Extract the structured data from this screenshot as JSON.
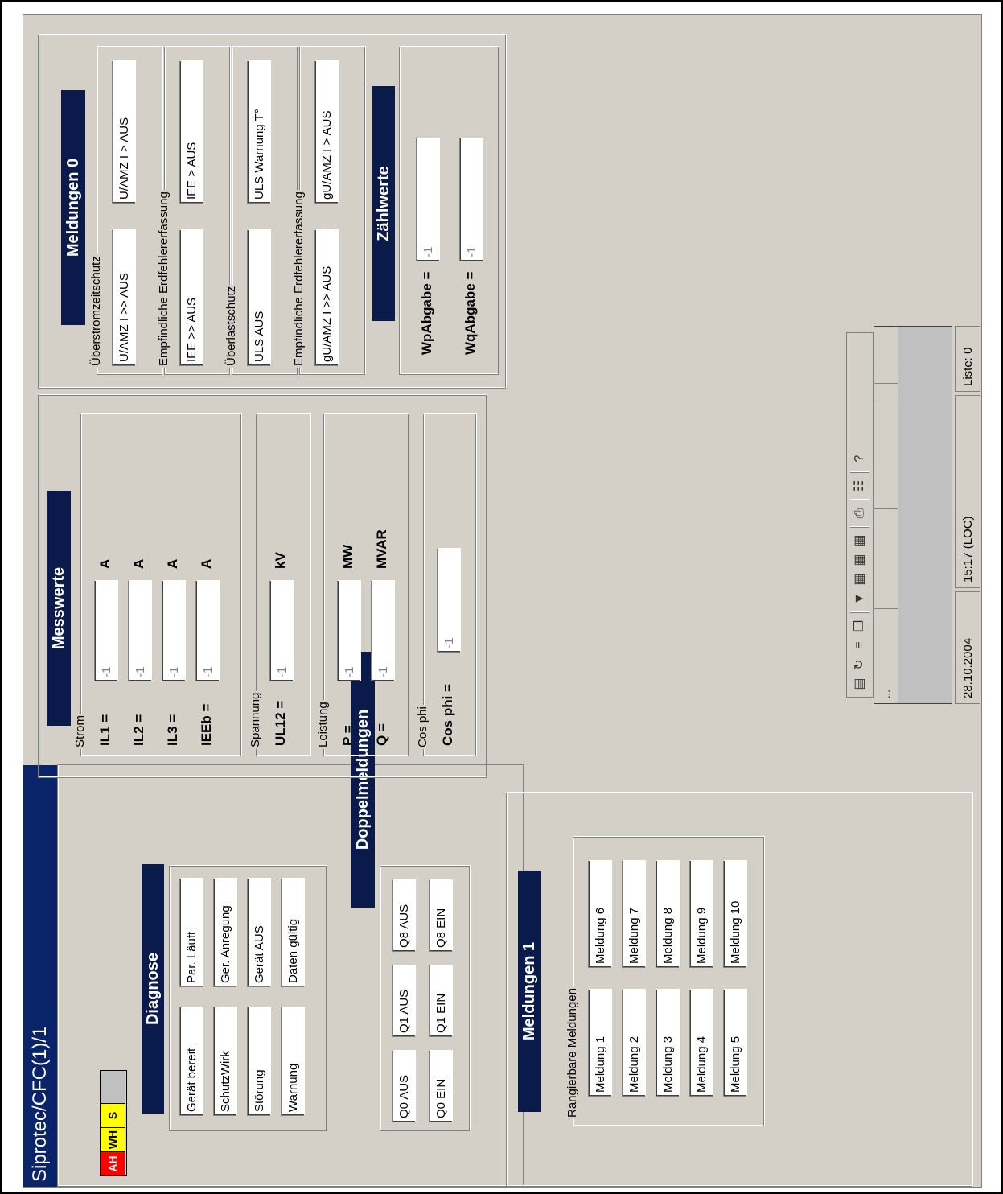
{
  "window": {
    "title": "Siprotec/CFC(1)/1"
  },
  "leds": [
    {
      "label": "AH",
      "color": "#ff0000"
    },
    {
      "label": "WH",
      "color": "#ffff00"
    },
    {
      "label": "S",
      "color": "#ffff00"
    },
    {
      "label": "",
      "color": "#c0c0c0"
    }
  ],
  "diagnose": {
    "title": "Diagnose",
    "items": [
      "Gerät bereit",
      "Par. Läuft",
      "SchutzWirk",
      "Ger. Anregung",
      "Störung",
      "Gerät AUS",
      "Warnung",
      "Daten gültig"
    ]
  },
  "doppelmeldungen": {
    "title": "Doppelmeldungen",
    "items": [
      "Q0 AUS",
      "Q1 AUS",
      "Q8 AUS",
      "Q0 EIN",
      "Q1 EIN",
      "Q8 EIN"
    ]
  },
  "meldungen1": {
    "title": "Meldungen 1",
    "group_label": "Rangierbare Meldungen",
    "items": [
      "Meldung 1",
      "Meldung 6",
      "Meldung 2",
      "Meldung 7",
      "Meldung 3",
      "Meldung 8",
      "Meldung 4",
      "Meldung 9",
      "Meldung 5",
      "Meldung 10"
    ]
  },
  "messwerte": {
    "title": "Messwerte",
    "strom": {
      "label": "Strom",
      "rows": [
        {
          "label": "IL1 =",
          "value": "-1",
          "unit": "A"
        },
        {
          "label": "IL2 =",
          "value": "-1",
          "unit": "A"
        },
        {
          "label": "IL3 =",
          "value": "-1",
          "unit": "A"
        },
        {
          "label": "IEEb =",
          "value": "-1",
          "unit": "A"
        }
      ]
    },
    "spannung": {
      "label": "Spannung",
      "rows": [
        {
          "label": "UL12 =",
          "value": "-1",
          "unit": "kV"
        }
      ]
    },
    "leistung": {
      "label": "Leistung",
      "rows": [
        {
          "label": "P =",
          "value": "-1",
          "unit": "MW"
        },
        {
          "label": "Q =",
          "value": "-1",
          "unit": "MVAR"
        }
      ]
    },
    "cosphi": {
      "label": "Cos phi",
      "rows": [
        {
          "label": "Cos phi =",
          "value": "-1"
        }
      ]
    }
  },
  "meldungen0": {
    "title": "Meldungen 0",
    "groups": [
      {
        "label": "Überstromzeitschutz",
        "items": [
          "U/AMZ I >> AUS",
          "U/AMZ I > AUS"
        ]
      },
      {
        "label": "Empfindliche Erdfehlererfassung",
        "items": [
          "IEE >> AUS",
          "IEE > AUS"
        ]
      },
      {
        "label": "Überlastschutz",
        "items": [
          "ULS AUS",
          "ULS Warnung T°"
        ]
      },
      {
        "label": "Empfindliche Erdfehlererfassung",
        "items": [
          "gU/AMZ I >> AUS",
          "gU/AMZ I > AUS"
        ]
      }
    ]
  },
  "zaehlwerte": {
    "title": "Zählwerte",
    "rows": [
      {
        "label": "WpAbgabe =",
        "value": "-1"
      },
      {
        "label": "WqAbgabe =",
        "value": "-1"
      }
    ]
  },
  "list": {
    "first_column": "..."
  },
  "statusbar": {
    "date": "28.10.2004",
    "time": "15:17 (LOC)",
    "list": "Liste: 0"
  }
}
